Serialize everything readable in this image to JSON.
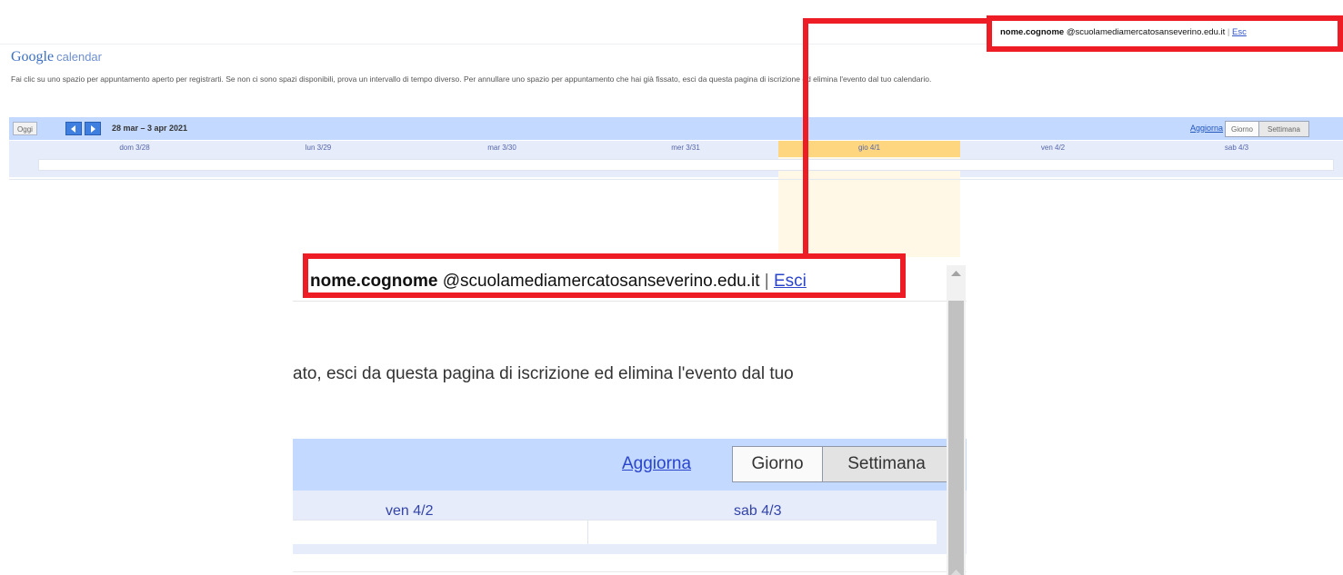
{
  "app": {
    "logo_google": "Google",
    "logo_product": "calendar"
  },
  "account": {
    "username": "nome.cognome",
    "domain": "@scuolamediamercatosanseverino.edu.it",
    "separator": "|",
    "logout_label": "Esci",
    "logout_label_small_visible": "Esc"
  },
  "instructions": "Fai clic su uno spazio per appuntamento aperto per registrarti. Se non ci sono spazi disponibili, prova un intervallo di tempo diverso. Per annullare uno spazio per appuntamento che hai già fissato, esci da questa pagina di iscrizione ed elimina l'evento dal tuo calendario.",
  "instructions_zoom": "ato, esci da questa pagina di iscrizione ed elimina l'evento dal tuo",
  "toolbar": {
    "today_label": "Oggi",
    "date_range": "28 mar – 3 apr 2021",
    "refresh_label": "Aggiorna",
    "day_view_label": "Giorno",
    "week_view_label": "Settimana"
  },
  "days": [
    {
      "label": "dom 3/28"
    },
    {
      "label": "lun 3/29"
    },
    {
      "label": "mar 3/30"
    },
    {
      "label": "mer 3/31"
    },
    {
      "label": "gio 4/1",
      "today": true
    },
    {
      "label": "ven 4/2"
    },
    {
      "label": "sab 4/3"
    }
  ],
  "colors": {
    "highlight_red": "#ee1c24",
    "toolbar_blue": "#c3d9ff",
    "today_column": "#ffd680",
    "link_blue": "#2a45cc"
  },
  "icons": {
    "prev": "chevron-left-icon",
    "next": "chevron-right-icon",
    "scroll_up": "triangle-up-icon"
  }
}
